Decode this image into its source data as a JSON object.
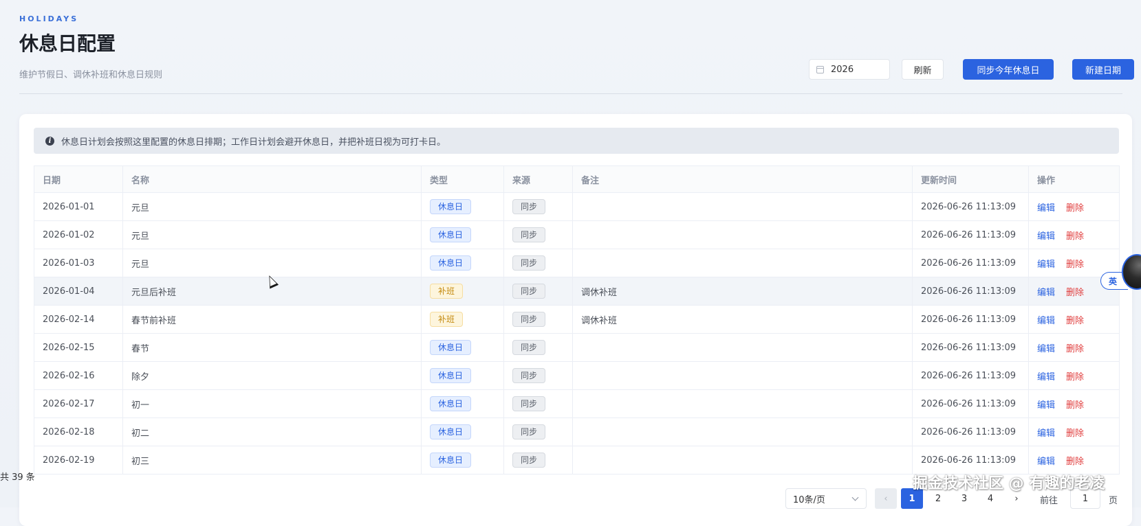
{
  "header": {
    "eyebrow": "HOLIDAYS",
    "title": "休息日配置",
    "subtitle": "维护节假日、调休补班和休息日规则"
  },
  "toolbar": {
    "year_value": "2026",
    "refresh_label": "刷新",
    "sync_label": "同步今年休息日",
    "new_label": "新建日期"
  },
  "alert": {
    "icon": "info-icon",
    "text": "休息日计划会按照这里配置的休息日排期；工作日计划会避开休息日，并把补班日视为可打卡日。"
  },
  "table": {
    "columns": [
      "日期",
      "名称",
      "类型",
      "来源",
      "备注",
      "更新时间",
      "操作"
    ],
    "edit_label": "编辑",
    "delete_label": "删除",
    "rows": [
      {
        "date": "2026-01-01",
        "name": "元旦",
        "type": "休息日",
        "source": "同步",
        "remark": "",
        "updated": "2026-06-26 11:13:09"
      },
      {
        "date": "2026-01-02",
        "name": "元旦",
        "type": "休息日",
        "source": "同步",
        "remark": "",
        "updated": "2026-06-26 11:13:09"
      },
      {
        "date": "2026-01-03",
        "name": "元旦",
        "type": "休息日",
        "source": "同步",
        "remark": "",
        "updated": "2026-06-26 11:13:09"
      },
      {
        "date": "2026-01-04",
        "name": "元旦后补班",
        "type": "补班",
        "source": "同步",
        "remark": "调休补班",
        "updated": "2026-06-26 11:13:09"
      },
      {
        "date": "2026-02-14",
        "name": "春节前补班",
        "type": "补班",
        "source": "同步",
        "remark": "调休补班",
        "updated": "2026-06-26 11:13:09"
      },
      {
        "date": "2026-02-15",
        "name": "春节",
        "type": "休息日",
        "source": "同步",
        "remark": "",
        "updated": "2026-06-26 11:13:09"
      },
      {
        "date": "2026-02-16",
        "name": "除夕",
        "type": "休息日",
        "source": "同步",
        "remark": "",
        "updated": "2026-06-26 11:13:09"
      },
      {
        "date": "2026-02-17",
        "name": "初一",
        "type": "休息日",
        "source": "同步",
        "remark": "",
        "updated": "2026-06-26 11:13:09"
      },
      {
        "date": "2026-02-18",
        "name": "初二",
        "type": "休息日",
        "source": "同步",
        "remark": "",
        "updated": "2026-06-26 11:13:09"
      },
      {
        "date": "2026-02-19",
        "name": "初三",
        "type": "休息日",
        "source": "同步",
        "remark": "",
        "updated": "2026-06-26 11:13:09"
      }
    ]
  },
  "pagination": {
    "total_text": "共 39 条",
    "page_size": "10条/页",
    "pages": [
      "1",
      "2",
      "3",
      "4"
    ],
    "current_page": "1",
    "jump_prefix": "前往",
    "jump_value": "1",
    "jump_suffix": "页"
  },
  "overlay": {
    "lang_label": "英",
    "watermark": "掘金技术社区 @ 有趣的老凌"
  },
  "colors": {
    "primary": "#2b63e0",
    "danger": "#e03d3d",
    "holiday_tag": "#e6efff",
    "workday_tag": "#fdf5dd"
  }
}
